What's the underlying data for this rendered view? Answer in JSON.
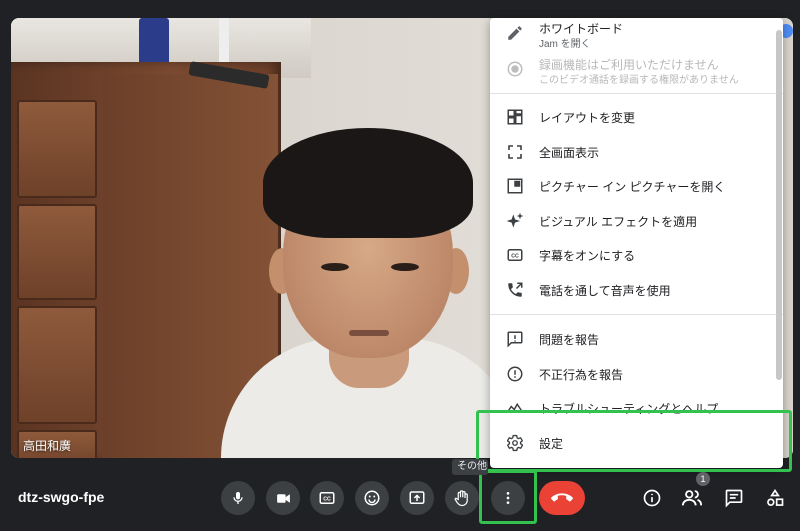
{
  "meeting_code": "dtz-swgo-fpe",
  "participant": {
    "name": "高田和廣"
  },
  "menu": {
    "whiteboard": {
      "label": "ホワイトボード",
      "sublabel": "Jam を開く",
      "icon": "pen-icon"
    },
    "recording": {
      "label": "録画機能はご利用いただけません",
      "sublabel": "このビデオ通話を録画する権限がありません",
      "icon": "record-icon"
    },
    "items": [
      {
        "label": "レイアウトを変更",
        "icon": "layout-icon"
      },
      {
        "label": "全画面表示",
        "icon": "fullscreen-icon"
      },
      {
        "label": "ピクチャー イン ピクチャーを開く",
        "icon": "picture-in-picture-icon"
      },
      {
        "label": "ビジュアル エフェクトを適用",
        "icon": "sparkle-icon"
      },
      {
        "label": "字幕をオンにする",
        "icon": "captions-icon"
      },
      {
        "label": "電話を通して音声を使用",
        "icon": "phone-forward-icon"
      }
    ],
    "items2": [
      {
        "label": "問題を報告",
        "icon": "feedback-icon"
      },
      {
        "label": "不正行為を報告",
        "icon": "report-icon"
      },
      {
        "label": "トラブルシューティングとヘルプ",
        "icon": "troubleshoot-icon"
      }
    ],
    "settings": {
      "label": "設定",
      "icon": "gear-icon"
    }
  },
  "controls": {
    "more_tooltip": "その他のオプション",
    "participants_count": "1"
  },
  "colors": {
    "highlight": "#33c24d",
    "end_call": "#ea4335",
    "bar_bg": "#202124"
  }
}
